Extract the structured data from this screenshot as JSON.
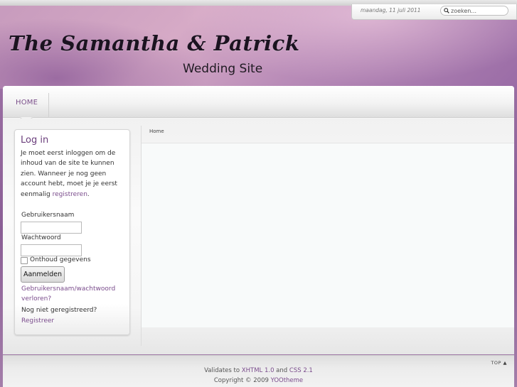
{
  "header": {
    "date": "maandag, 11 juli 2011",
    "search_placeholder": "zoeken...",
    "title": "The Samantha & Patrick",
    "subtitle": "Wedding Site"
  },
  "menu": {
    "items": [
      {
        "label": "HOME",
        "active": true
      }
    ]
  },
  "breadcrumb": "Home",
  "login": {
    "title": "Log in",
    "intro": "Je moet eerst inloggen om de inhoud van de site te kunnen zien. Wanneer je nog geen account hebt, moet je je eerst eenmalig ",
    "intro_link": "registreren",
    "intro_end": ".",
    "username_label": "Gebruikersnaam",
    "password_label": "Wachtwoord",
    "remember_label": "Onthoud gegevens",
    "submit_label": "Aanmelden",
    "forgot_link": "Gebruikersnaam/wachtwoord verloren?",
    "not_registered": "Nog niet geregistreerd?",
    "register_link": "Registreer"
  },
  "footer": {
    "top_label": "TOP",
    "validates_prefix": "Validates to ",
    "xhtml_link": "XHTML 1.0",
    "and_text": " and ",
    "css_link": "CSS 2.1",
    "copyright_prefix": "Copyright © 2009 ",
    "yootheme_link": "YOOtheme"
  },
  "colors": {
    "accent": "#7a4c8c",
    "header_pink": "#d6aac6",
    "header_purple": "#9a6ca6"
  }
}
